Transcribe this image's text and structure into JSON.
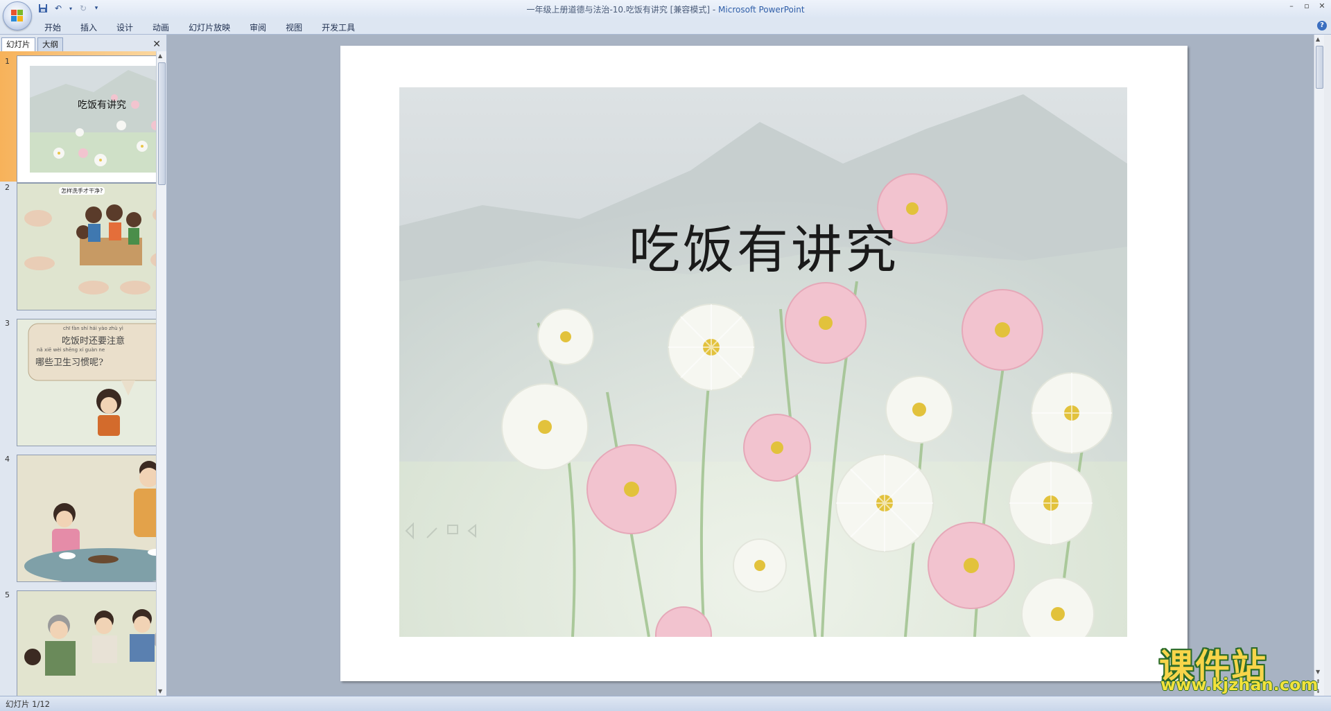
{
  "window": {
    "title": "一年级上册道德与法治-10.吃饭有讲究 [兼容模式]",
    "separator": "-",
    "app_name": "Microsoft PowerPoint",
    "controls": [
      "–",
      "▫",
      "✕"
    ]
  },
  "ribbon": {
    "tabs": [
      "开始",
      "插入",
      "设计",
      "动画",
      "幻灯片放映",
      "审阅",
      "视图",
      "开发工具"
    ],
    "help": "?"
  },
  "left_pane": {
    "tabs": [
      "幻灯片",
      "大纲"
    ],
    "close": "✕",
    "thumbnails": [
      {
        "number": "1",
        "title": "吃饭有讲究"
      },
      {
        "number": "2",
        "title": "怎样洗手才干净?"
      },
      {
        "number": "3",
        "pinyin1": "chī fàn shí hái yào zhù yì",
        "text1": "吃饭时还要注意",
        "pinyin2": "nǎ xiē wèi shēng xí guàn ne",
        "text2": "哪些卫生习惯呢?"
      },
      {
        "number": "4"
      },
      {
        "number": "5"
      }
    ]
  },
  "slide": {
    "title": "吃饭有讲究"
  },
  "status": {
    "slide_indicator": "幻灯片 1/12"
  },
  "watermark": {
    "name": "课件站",
    "url": "www.kjzhan.com"
  }
}
